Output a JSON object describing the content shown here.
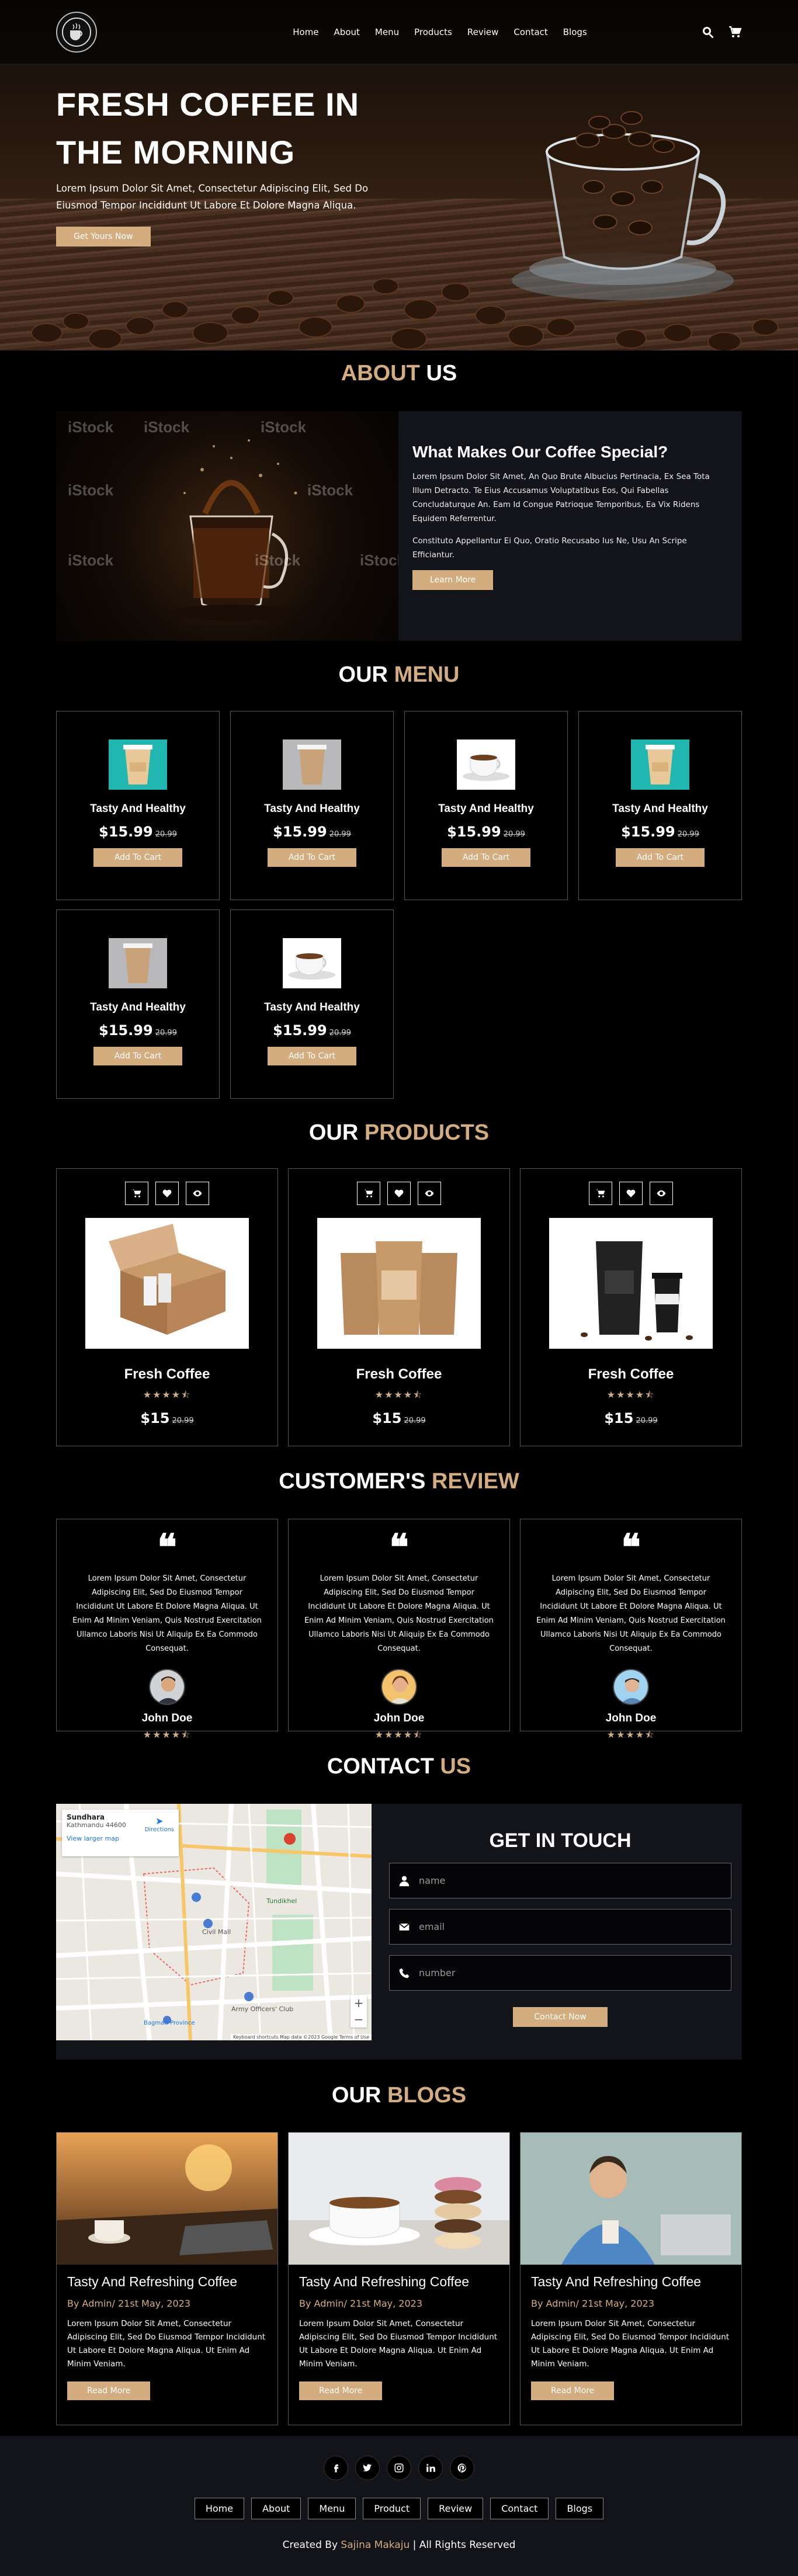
{
  "header": {
    "nav": [
      "Home",
      "About",
      "Menu",
      "Products",
      "Review",
      "Contact",
      "Blogs"
    ]
  },
  "hero": {
    "title_line1": "FRESH COFFEE IN",
    "title_line2": "THE MORNING",
    "text": "Lorem Ipsum Dolor Sit Amet, Consectetur Adipiscing Elit, Sed Do Eiusmod Tempor Incididunt Ut Labore Et Dolore Magna Aliqua.",
    "button": "Get Yours Now"
  },
  "about": {
    "title_a": "ABOUT",
    "title_b": "US",
    "heading": "What Makes Our Coffee Special?",
    "p1": "Lorem Ipsum Dolor Sit Amet, An Quo Brute Albucius Pertinacia, Ex Sea Tota Illum Detracto. Te Eius Accusamus Voluptatibus Eos, Qui Fabellas Concludaturque An. Eam Id Congue Patrioque Temporibus, Ea Vix Ridens Equidem Referrentur.",
    "p2": "Constituto Appellantur Ei Quo, Oratio Recusabo Ius Ne, Usu An Scripe Efficiantur.",
    "button": "Learn More",
    "watermark": "iStock"
  },
  "menu": {
    "title_a": "OUR",
    "title_b": "MENU",
    "items": [
      {
        "name": "Tasty And Healthy",
        "price": "$15.99",
        "old": "20.99",
        "button": "Add To Cart"
      },
      {
        "name": "Tasty And Healthy",
        "price": "$15.99",
        "old": "20.99",
        "button": "Add To Cart"
      },
      {
        "name": "Tasty And Healthy",
        "price": "$15.99",
        "old": "20.99",
        "button": "Add To Cart"
      },
      {
        "name": "Tasty And Healthy",
        "price": "$15.99",
        "old": "20.99",
        "button": "Add To Cart"
      },
      {
        "name": "Tasty And Healthy",
        "price": "$15.99",
        "old": "20.99",
        "button": "Add To Cart"
      },
      {
        "name": "Tasty And Healthy",
        "price": "$15.99",
        "old": "20.99",
        "button": "Add To Cart"
      }
    ]
  },
  "products": {
    "title_a": "OUR",
    "title_b": "PRODUCTS",
    "items": [
      {
        "name": "Fresh Coffee",
        "stars": "★★★★⯪",
        "price": "$15",
        "old": "20.99"
      },
      {
        "name": "Fresh Coffee",
        "stars": "★★★★⯪",
        "price": "$15",
        "old": "20.99"
      },
      {
        "name": "Fresh Coffee",
        "stars": "★★★★⯪",
        "price": "$15",
        "old": "20.99"
      }
    ]
  },
  "review": {
    "title_a": "CUSTOMER'S",
    "title_b": "REVIEW",
    "items": [
      {
        "text": "Lorem Ipsum Dolor Sit Amet, Consectetur Adipiscing Elit, Sed Do Eiusmod Tempor Incididunt Ut Labore Et Dolore Magna Aliqua. Ut Enim Ad Minim Veniam, Quis Nostrud Exercitation Ullamco Laboris Nisi Ut Aliquip Ex Ea Commodo Consequat.",
        "name": "John Doe",
        "stars": "★★★★⯪"
      },
      {
        "text": "Lorem Ipsum Dolor Sit Amet, Consectetur Adipiscing Elit, Sed Do Eiusmod Tempor Incididunt Ut Labore Et Dolore Magna Aliqua. Ut Enim Ad Minim Veniam, Quis Nostrud Exercitation Ullamco Laboris Nisi Ut Aliquip Ex Ea Commodo Consequat.",
        "name": "John Doe",
        "stars": "★★★★⯪"
      },
      {
        "text": "Lorem Ipsum Dolor Sit Amet, Consectetur Adipiscing Elit, Sed Do Eiusmod Tempor Incididunt Ut Labore Et Dolore Magna Aliqua. Ut Enim Ad Minim Veniam, Quis Nostrud Exercitation Ullamco Laboris Nisi Ut Aliquip Ex Ea Commodo Consequat.",
        "name": "John Doe",
        "stars": "★★★★⯪"
      }
    ]
  },
  "contact": {
    "title_a": "CONTACT",
    "title_b": "US",
    "heading": "GET IN TOUCH",
    "name_placeholder": "name",
    "email_placeholder": "email",
    "number_placeholder": "number",
    "button": "Contact Now",
    "map": {
      "place": "Sundhara",
      "sub": "Kathmandu 44600",
      "directions": "Directions",
      "larger": "View larger map",
      "label1": "Tundikhel",
      "label2": "Civil Mall",
      "label3": "Army Officers' Club",
      "label4": "Bagmati Province",
      "footer": "Keyboard shortcuts  Map data ©2023 Google  Terms of Use"
    }
  },
  "blogs": {
    "title_a": "OUR",
    "title_b": "BLOGS",
    "items": [
      {
        "title": "Tasty And Refreshing Coffee",
        "by": "By Admin/ 21st May, 2023",
        "text": "Lorem Ipsum Dolor Sit Amet, Consectetur Adipiscing Elit, Sed Do Eiusmod Tempor Incididunt Ut Labore Et Dolore Magna Aliqua. Ut Enim Ad Minim Veniam.",
        "button": "Read More"
      },
      {
        "title": "Tasty And Refreshing Coffee",
        "by": "By Admin/ 21st May, 2023",
        "text": "Lorem Ipsum Dolor Sit Amet, Consectetur Adipiscing Elit, Sed Do Eiusmod Tempor Incididunt Ut Labore Et Dolore Magna Aliqua. Ut Enim Ad Minim Veniam.",
        "button": "Read More"
      },
      {
        "title": "Tasty And Refreshing Coffee",
        "by": "By Admin/ 21st May, 2023",
        "text": "Lorem Ipsum Dolor Sit Amet, Consectetur Adipiscing Elit, Sed Do Eiusmod Tempor Incididunt Ut Labore Et Dolore Magna Aliqua. Ut Enim Ad Minim Veniam.",
        "button": "Read More"
      }
    ]
  },
  "footer": {
    "links": [
      "Home",
      "About",
      "Menu",
      "Product",
      "Review",
      "Contact",
      "Blogs"
    ],
    "credit_pre": "Created By",
    "credit_name": "Sajina Makaju",
    "credit_post": "| All Rights Reserved"
  },
  "colors": {
    "accent": "#d3ad7f",
    "background": "#000000",
    "panel": "#13131a"
  },
  "icons": [
    "search-icon",
    "cart-icon",
    "heart-icon",
    "eye-icon",
    "user-icon",
    "mail-icon",
    "phone-icon",
    "facebook-icon",
    "twitter-icon",
    "instagram-icon",
    "linkedin-icon",
    "pinterest-icon"
  ]
}
